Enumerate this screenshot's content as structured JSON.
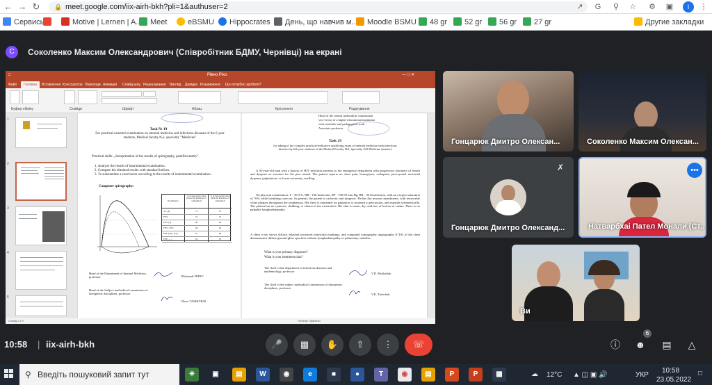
{
  "browser": {
    "url": "meet.google.com/iix-airh-bkh?pli=1&authuser=2",
    "profile_initial": "I",
    "bookmarks": [
      {
        "label": "Сервисы",
        "color": "#4285f4"
      },
      {
        "label": "",
        "color": "#ea4335"
      },
      {
        "label": "Motive | Lernen | A...",
        "color": "#d93025"
      },
      {
        "label": "Meet",
        "color": "#34a853"
      },
      {
        "label": "eBSMU",
        "color": "#fbbc04"
      },
      {
        "label": "Hippocrates",
        "color": "#1a73e8"
      },
      {
        "label": "День, що навчив м...",
        "color": "#5f6368"
      },
      {
        "label": "Moodle BSMU",
        "color": "#f29900"
      },
      {
        "label": "48 gr",
        "color": "#34a853"
      },
      {
        "label": "52 gr",
        "color": "#34a853"
      },
      {
        "label": "56 gr",
        "color": "#34a853"
      },
      {
        "label": "27 gr",
        "color": "#34a853"
      }
    ],
    "bookmarks_other": "Другие закладки"
  },
  "meet": {
    "presenter_initial": "С",
    "presenter_title": "Соколенко Максим Олександрович (Співробітник БДМУ, Чернівці) на екрані",
    "participants": [
      {
        "name": "Гонцарюк Дмитро Олексан..."
      },
      {
        "name": "Соколенко Максим Олексан..."
      },
      {
        "name": "Гонцарюк Дмитро Олександ..."
      },
      {
        "name": "Натварбхаі Пател Монали (Ст..."
      },
      {
        "name": "Ви"
      }
    ],
    "time": "10:58",
    "separator": "|",
    "meeting_code": "iix-airh-bkh",
    "participant_count": "6"
  },
  "powerpoint": {
    "title": "Рівно Ріхо",
    "tabs": [
      "Файл",
      "Головна",
      "Вставлення",
      "Конструктор",
      "Переходи",
      "Анімація",
      "Слайд-шоу",
      "Рецензування",
      "Вигляд",
      "Довідка",
      "Розширення",
      "Що потрібно зробити?"
    ],
    "ribbon_groups": [
      "Буфер обміну",
      "Слайди",
      "Шрифт",
      "Абзац",
      "Креслення",
      "Редагування"
    ],
    "status_left": "Слайд 2 з 9",
    "status_right": "Нотатки   Примітки",
    "thumb_numbers": [
      "1",
      "2",
      "3",
      "4",
      "5"
    ]
  },
  "slide": {
    "left": {
      "task": "Task № 19",
      "intro": "For practical-oriented examination on internal medicine and infectious diseases of the 6-year students, Medical faculty №3, speciality \"Medicine\"",
      "skills": "Practical skills: „Interpretation of the results of spirography, peakflowmetry\".",
      "items": [
        "1. Analyze the results of instrumental examination.",
        "2. Compare the obtained results with standard indices.",
        "3. To substantiate a conclusion according to the results of instrumental examination."
      ],
      "computer_spiro": "Computer spirography:",
      "table_headers": [
        "Parameters",
        "% of appropriate value (before the inhalation of salbutamol)",
        "% of appropriate value (after the inhalation of salbutamol)"
      ],
      "table_rows": [
        [
          "VC (I)",
          "73",
          "73"
        ],
        [
          "FVC",
          "74",
          "74"
        ],
        [
          "FEV (I)",
          "38",
          "40"
        ],
        [
          "FEV₁/FVC",
          "56",
          "61"
        ],
        [
          "PEF (exp. (I/s)",
          "67",
          "69"
        ],
        [
          "FEF₂₅₋₇₅",
          "33",
          "35"
        ]
      ],
      "head1": "Head of the Department of Internal Medicine, professor",
      "head1_name": "Oleksandr FEDIV",
      "head2": "Head of the Subject methodical commission of therapeutic disciplines, professor",
      "head2_name": "Viktor TASHCHUK"
    },
    "right": {
      "top1": "Head of the central methodical commission",
      "top2": "vice-rector of a higher educational institution",
      "top3": "with scientific and pedagogical work",
      "top4": "Associate professor",
      "task": "Task 19",
      "subtitle": "for taking of the complex practical-indicative qualifying exam of internal medicine with infectious diseases by 6th year students of the Medical Faculty №3, Specialty 222 Medicine (master)",
      "para1": "A 45-year-old man with a history of HIV infection presents to the emergency department with progressive shortness of breath and dyspnea on exertion for the past month. The patient reports no chest pain, hemoptysis, orthopnea, paroxysmal nocturnal dyspnea, palpitations, or lower-extremity swelling.",
      "para2": "On physical examination: T - 38.3°C, HR - 136 beats/min, BP - 100/70 mm Hg, RR - 30 breaths/min, with an oxygen saturation of 76% while breathing room air. In general, the patient is cachectic and dyspneic. He has dry mucous membranes, with removable white plaques throughout the oropharynx. His chest is nontender on palpation, is resonant to percussion, and expands symmetrically. The patient has no cyanosis, clubbing, or edema of the extremities. His skin is warm, dry, and free of lesions or rashes. There is no palpable lymphadenopathy.",
      "para3": "A chest x-ray shows diffuse, bilateral increased interstitial markings, and computed tomographic angiography (CTA) of the chest demonstrates diffuse ground-glass opacities without lymphadenopathy or pulmonary embolus.",
      "q1": "What is your primary diagnosis?",
      "q2": "What is your treatment plan?",
      "chief1": "The chief of the department of infectious diseases and epidemiology, professor",
      "chief1_name": "V.D. Moskaliuk",
      "chief2": "The chief of the subject methodical commission of therapeutic disciplines, professor",
      "chief2_name": "V.K. Tashchuk"
    }
  },
  "taskbar": {
    "search_placeholder": "Введіть пошуковий запит тут",
    "weather": "12°C",
    "lang": "УКР",
    "time": "10:58",
    "date": "23.05.2022"
  }
}
